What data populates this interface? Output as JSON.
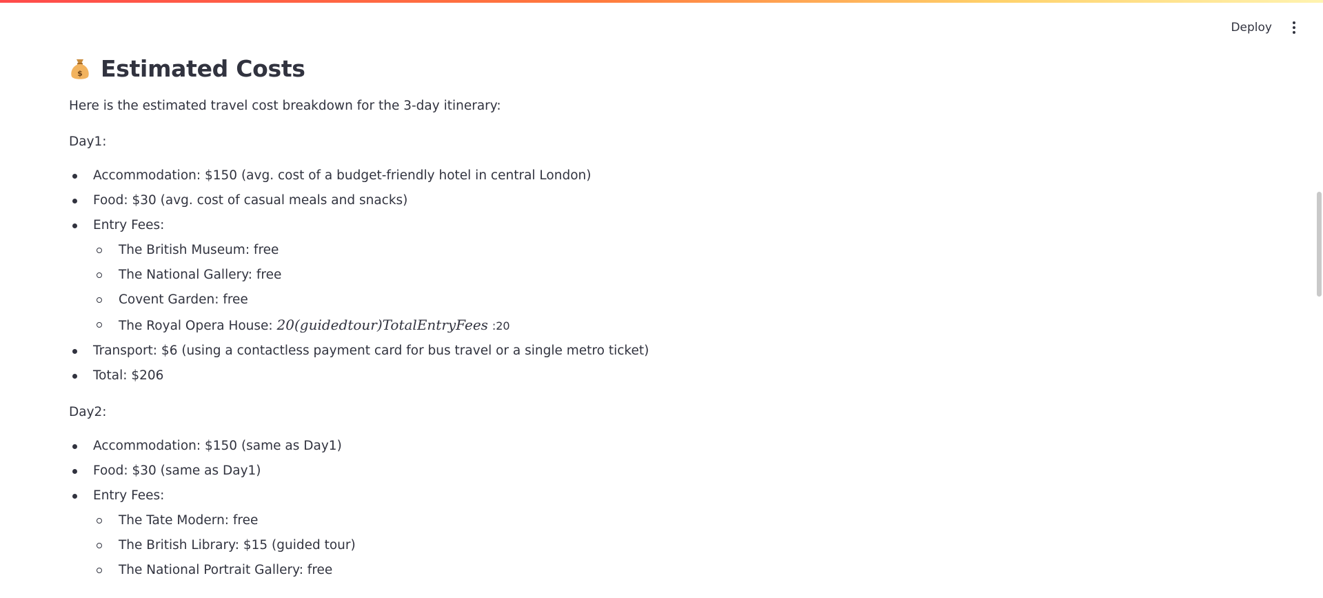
{
  "header": {
    "deploy_label": "Deploy",
    "menu_icon": "vertical-dots-icon"
  },
  "page": {
    "title_icon": "money-bag-icon",
    "title": "Estimated Costs",
    "intro": "Here is the estimated travel cost breakdown for the 3-day itinerary:"
  },
  "day1": {
    "label": "Day1:",
    "accommodation": "Accommodation: $150 (avg. cost of a budget-friendly hotel in central London)",
    "food": "Food: $30 (avg. cost of casual meals and snacks)",
    "entry_fees": "Entry Fees:",
    "entries": [
      "The British Museum: free",
      "The National Gallery: free",
      "Covent Garden: free"
    ],
    "opera_prefix": "The Royal Opera House: ",
    "opera_math": "20(guidedtour)TotalEntryFees",
    "opera_suffix": ":20",
    "transport": "Transport: $6 (using a contactless payment card for bus travel or a single metro ticket)",
    "total": "Total: $206"
  },
  "day2": {
    "label": "Day2:",
    "accommodation": "Accommodation: $150 (same as Day1)",
    "food": "Food: $30 (same as Day1)",
    "entry_fees": "Entry Fees:",
    "entries": [
      "The Tate Modern: free",
      "The British Library: $15 (guided tour)",
      "The National Portrait Gallery: free"
    ]
  }
}
